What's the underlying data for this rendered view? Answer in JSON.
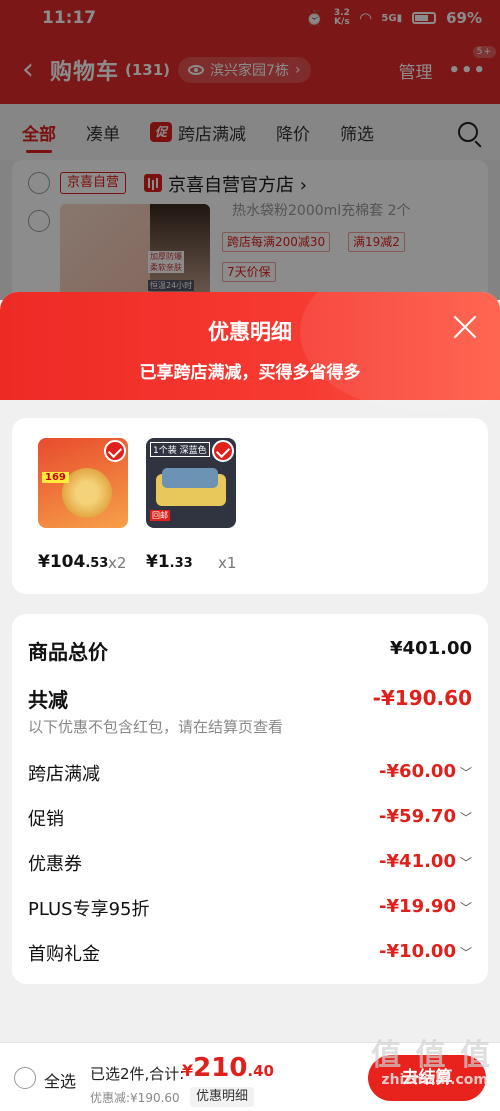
{
  "status_bar": {
    "time": "11:17",
    "speed": "3.2",
    "speed_unit": "K/s",
    "signal": "5G",
    "battery": "69%"
  },
  "header": {
    "title": "购物车",
    "count": "(131)",
    "address": "滨兴家园7栋",
    "manage": "管理",
    "more_badge": "5+"
  },
  "tabs": [
    {
      "label": "全部",
      "active": true
    },
    {
      "label": "凑单"
    },
    {
      "label": "跨店满减",
      "badge": "促"
    },
    {
      "label": "降价"
    },
    {
      "label": "筛选"
    }
  ],
  "store": {
    "tag": "京喜自营",
    "name": "京喜自营官方店",
    "product_title": "热水袋粉2000ml充棉套 2个",
    "img_labels": [
      "加厚防爆",
      "柔软亲肤",
      "恒温24小时"
    ],
    "chips": [
      "跨店每满200减30",
      "满19减2",
      "7天价保"
    ]
  },
  "sheet": {
    "title": "优惠明细",
    "subtitle": "已享跨店满减，买得多省得多",
    "items": [
      {
        "price_int": "¥104",
        "price_dec": ".53",
        "qty": "x2",
        "thumb_text": "169"
      },
      {
        "price_int": "¥1",
        "price_dec": ".33",
        "qty": "x1",
        "thumb_tag": "1个装",
        "thumb_tag2": "深蓝色",
        "thumb_promo": "回邮"
      }
    ],
    "summary": {
      "total_label": "商品总价",
      "total_value": "¥401.00",
      "discount_label": "共减",
      "discount_value": "-¥190.60",
      "note": "以下优惠不包含红包，请在结算页查看",
      "rows": [
        {
          "label": "跨店满减",
          "value": "-¥60.00"
        },
        {
          "label": "促销",
          "value": "-¥59.70"
        },
        {
          "label": "优惠券",
          "value": "-¥41.00"
        },
        {
          "label": "PLUS专享95折",
          "value": "-¥19.90"
        },
        {
          "label": "首购礼金",
          "value": "-¥10.00"
        }
      ]
    }
  },
  "bottom_bar": {
    "select_all": "全选",
    "selected": "已选2件,合计:",
    "currency": "¥",
    "total_int": "210",
    "total_dec": ".40",
    "discount": "优惠减:¥190.60",
    "detail_btn": "优惠明细",
    "checkout": "去结算",
    "watermark": "值 值 值",
    "watermark_url": "zhizhizhi.com"
  }
}
